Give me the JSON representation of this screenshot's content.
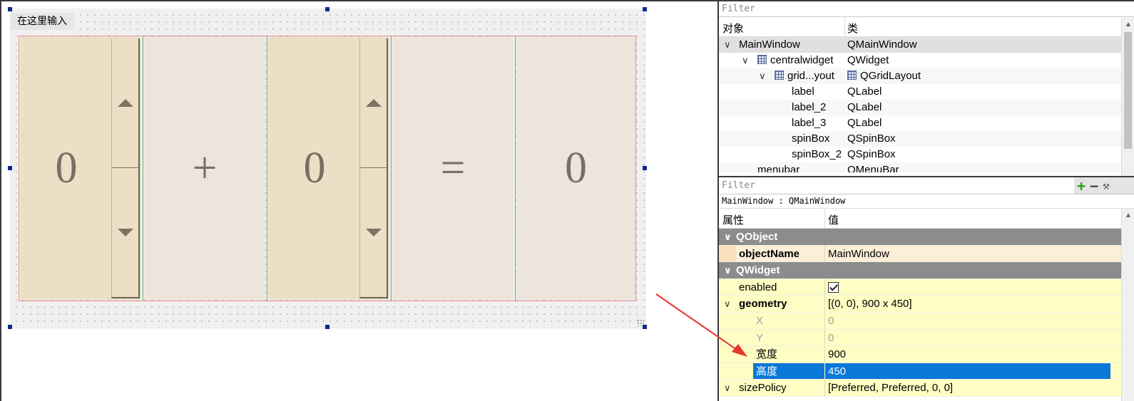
{
  "designer": {
    "menubar_placeholder": "在这里输入",
    "spin1_value": "0",
    "plus_label": "+",
    "spin2_value": "0",
    "equals_label": "=",
    "result_value": "0"
  },
  "object_inspector": {
    "filter_placeholder": "Filter",
    "headers": {
      "object": "对象",
      "class": "类"
    },
    "rows": [
      {
        "name": "MainWindow",
        "cls": "QMainWindow"
      },
      {
        "name": "centralwidget",
        "cls": "QWidget"
      },
      {
        "name": "grid...yout",
        "cls": "QGridLayout"
      },
      {
        "name": "label",
        "cls": "QLabel"
      },
      {
        "name": "label_2",
        "cls": "QLabel"
      },
      {
        "name": "label_3",
        "cls": "QLabel"
      },
      {
        "name": "spinBox",
        "cls": "QSpinBox"
      },
      {
        "name": "spinBox_2",
        "cls": "QSpinBox"
      },
      {
        "name": "menubar",
        "cls": "QMenuBar"
      }
    ]
  },
  "property_editor": {
    "filter_placeholder": "Filter",
    "object_line": "MainWindow : QMainWindow",
    "headers": {
      "property": "属性",
      "value": "值"
    },
    "groups": {
      "qobject": "QObject",
      "qwidget": "QWidget"
    },
    "rows": {
      "objectName": {
        "name": "objectName",
        "value": "MainWindow"
      },
      "enabled": {
        "name": "enabled",
        "value": ""
      },
      "geometry": {
        "name": "geometry",
        "value": "[(0, 0), 900 x 450]"
      },
      "x": {
        "name": "X",
        "value": "0"
      },
      "y": {
        "name": "Y",
        "value": "0"
      },
      "width": {
        "name": "宽度",
        "value": "900"
      },
      "height": {
        "name": "高度",
        "value": "450"
      },
      "sizePolicy": {
        "name": "sizePolicy",
        "value": "[Preferred, Preferred, 0, 0]"
      }
    }
  },
  "colors": {
    "spin_bg": "#ebdfc6",
    "label_bg": "#ede4dc",
    "group_header": "#8c8c8c",
    "property_row": "#fefec4",
    "selection": "#0a78d7",
    "arrow": "#e8372b"
  }
}
